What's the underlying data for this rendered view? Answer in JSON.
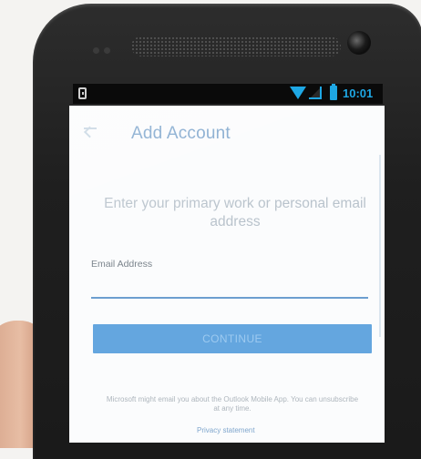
{
  "status_bar": {
    "time": "10:01",
    "icons": [
      "notification-icon",
      "wifi-icon",
      "signal-icon",
      "battery-icon"
    ]
  },
  "app_bar": {
    "title": "Add Account",
    "back_icon": "back-arrow-icon"
  },
  "form": {
    "prompt": "Enter your primary work or personal email address",
    "email_label": "Email Address",
    "email_value": "",
    "continue_label": "CONTINUE",
    "disclaimer": "Microsoft might email you about the Outlook Mobile App. You can unsubscribe at any time.",
    "privacy_label": "Privacy statement"
  },
  "colors": {
    "accent": "#64a6df",
    "status_accent": "#1ea7e4",
    "title": "#7fa6cd"
  }
}
